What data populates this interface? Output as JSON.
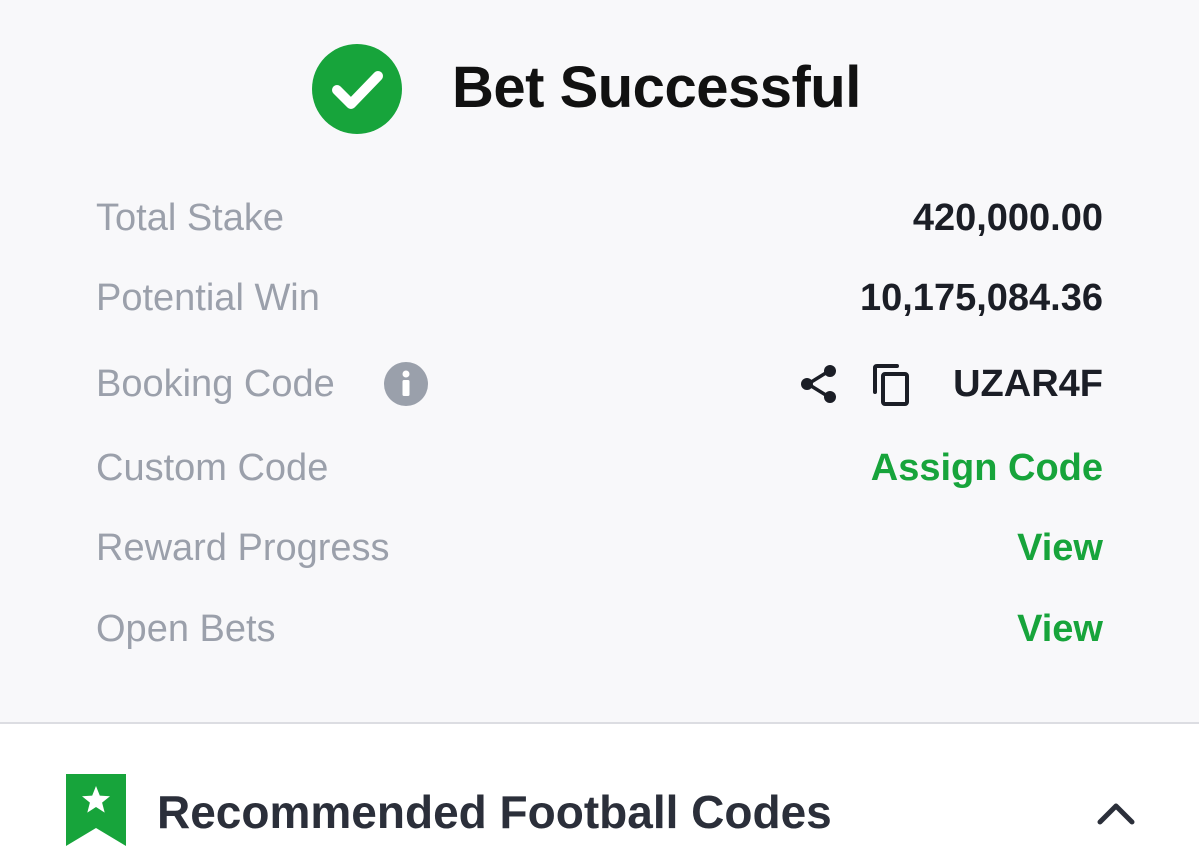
{
  "header": {
    "title": "Bet Successful",
    "icon": "check-circle-icon",
    "icon_color": "#17a43b"
  },
  "summary": {
    "total_stake": {
      "label": "Total Stake",
      "value": "420,000.00"
    },
    "potential_win": {
      "label": "Potential Win",
      "value": "10,175,084.36"
    },
    "booking_code": {
      "label": "Booking Code",
      "value": "UZAR4F",
      "icons": [
        "info-icon",
        "share-icon",
        "copy-icon"
      ]
    },
    "custom_code": {
      "label": "Custom Code",
      "action": "Assign Code"
    },
    "reward_progress": {
      "label": "Reward Progress",
      "action": "View"
    },
    "open_bets": {
      "label": "Open Bets",
      "action": "View"
    }
  },
  "recommended": {
    "title": "Recommended Football Codes",
    "icons": [
      "bookmark-star-icon",
      "chevron-up-icon"
    ]
  },
  "colors": {
    "accent_green": "#17a43b",
    "label_gray": "#9ba0ab",
    "value_dark": "#1b1e26",
    "background": "#f8f8fa"
  }
}
